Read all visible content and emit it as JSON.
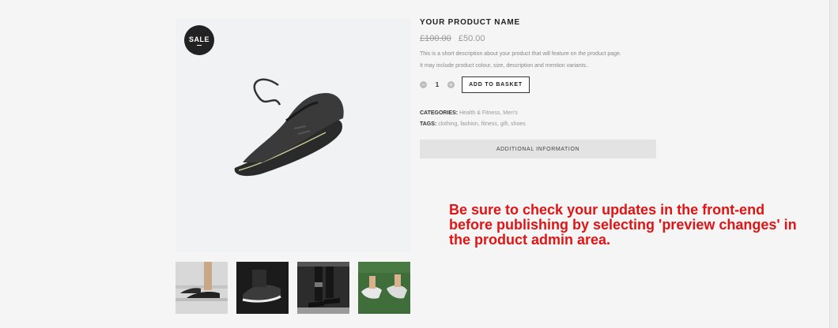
{
  "product": {
    "name": "YOUR PRODUCT NAME",
    "old_price": "£100.00",
    "price": "£50.00",
    "description_line1": "This is a short description about your product that will feature on the product page.",
    "description_line2": "It may include product colour, size, description and mention variants..",
    "badge": "SALE"
  },
  "cart": {
    "minus": "−",
    "plus": "+",
    "quantity": "1",
    "add_to_basket": "ADD TO BASKET"
  },
  "meta": {
    "categories_label": "CATEGORIES:",
    "categories": "Health & Fitness, Men's",
    "tags_label": "TAGS:",
    "tags": "clothing, fashion, fitness, gift, shoes"
  },
  "tabs": {
    "additional_information": "ADDITIONAL INFORMATION"
  },
  "annotation": {
    "text": "Be sure to check your updates in the front-end before publishing by selecting 'preview changes' in the product admin area."
  }
}
